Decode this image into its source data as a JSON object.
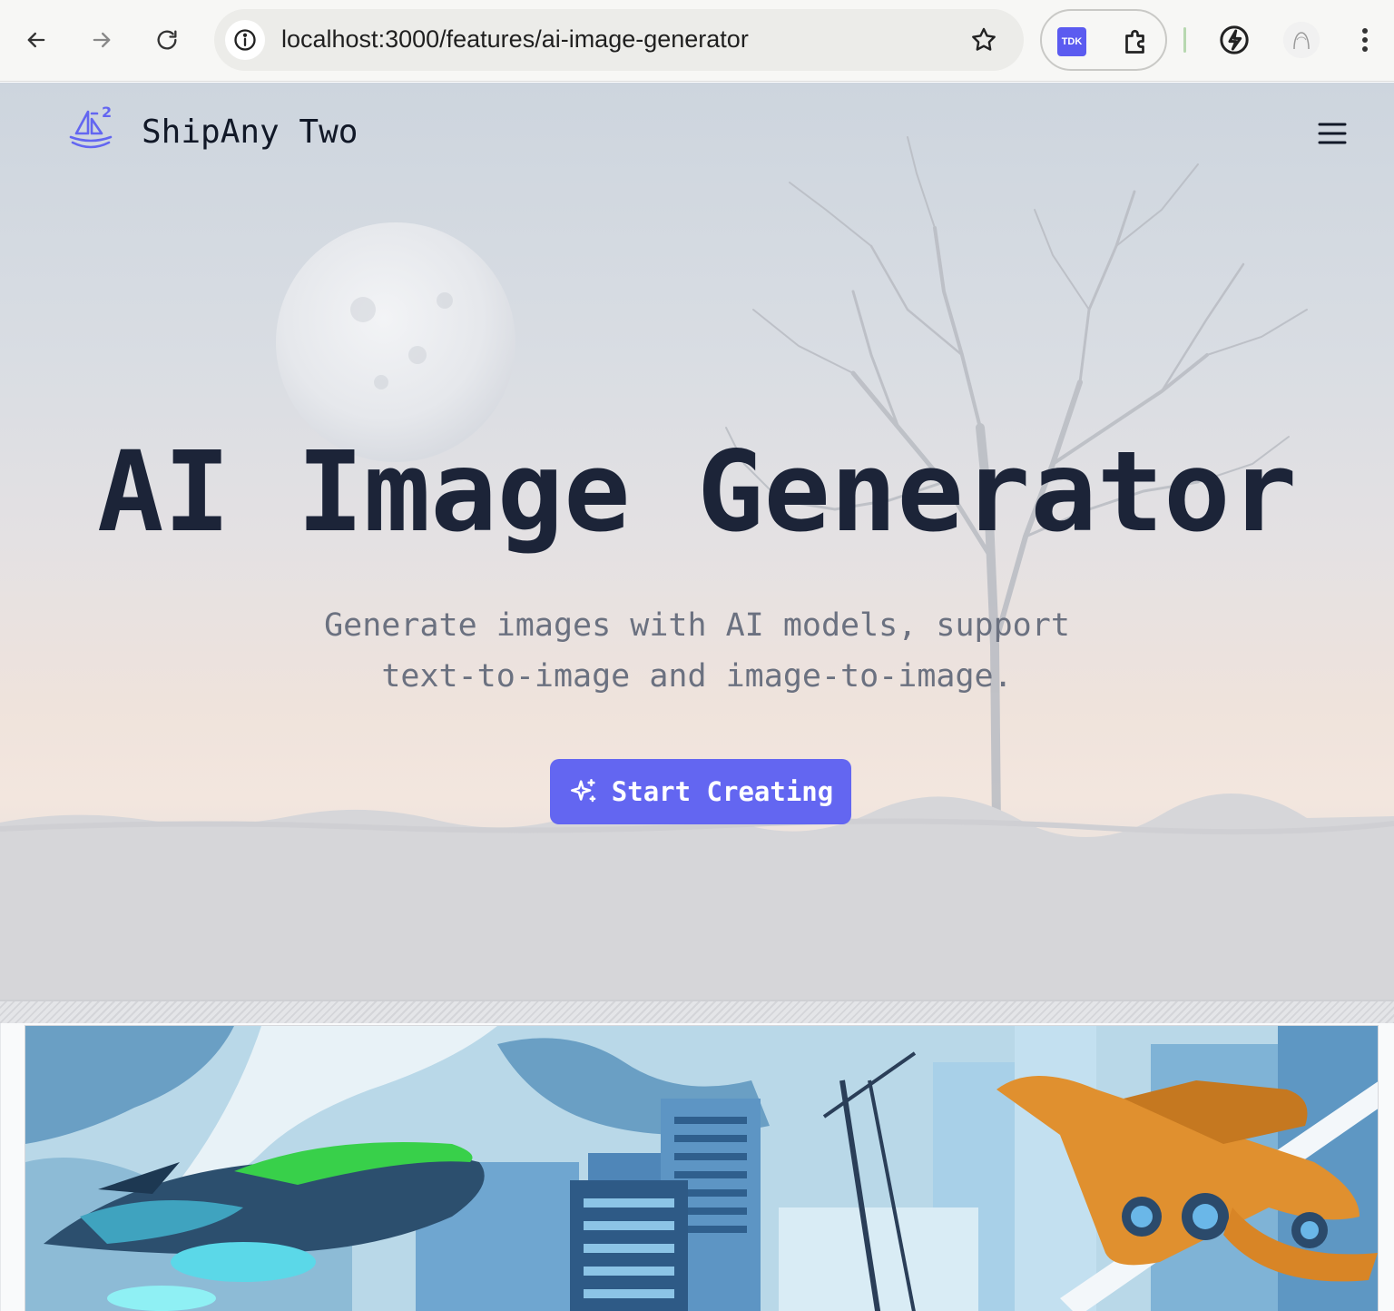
{
  "browser": {
    "url": "localhost:3000/features/ai-image-generator",
    "extension_badge": "TDK",
    "icons": [
      "back-arrow-icon",
      "forward-arrow-icon",
      "reload-icon",
      "site-info-icon",
      "bookmark-star-icon",
      "puzzle-icon",
      "bolt-icon",
      "profile-avatar",
      "kebab-menu-icon"
    ]
  },
  "header": {
    "brand": "ShipAny Two",
    "logo_icon": "sailboat-logo-icon",
    "menu_icon": "hamburger-menu-icon"
  },
  "hero": {
    "title": "AI Image Generator",
    "subtitle_line1": "Generate images with AI models, support",
    "subtitle_line2": "text-to-image and image-to-image.",
    "cta_label": "Start Creating",
    "cta_icon": "sparkles-icon"
  },
  "colors": {
    "accent": "#6366f1",
    "title": "#1c2438",
    "subtitle": "#6b7180"
  }
}
